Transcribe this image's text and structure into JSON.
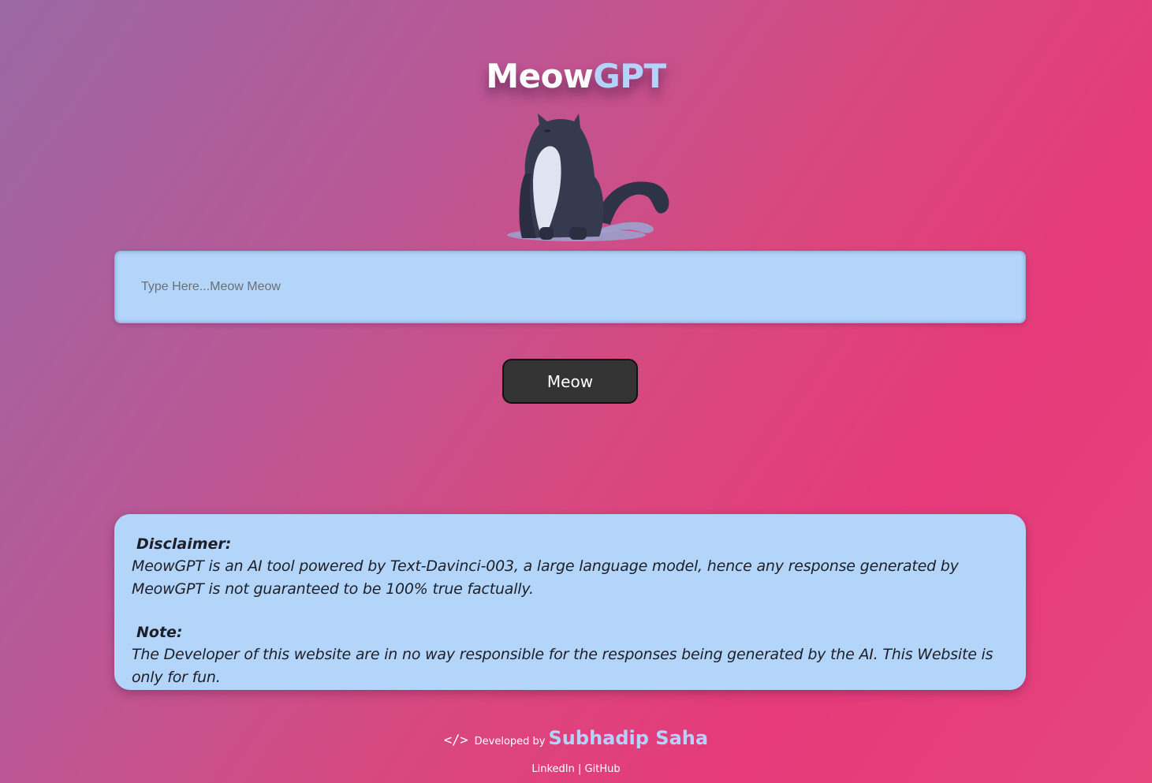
{
  "header": {
    "title_part1": "Meow",
    "title_part2": "GPT"
  },
  "prompt": {
    "placeholder": "Type Here...Meow Meow",
    "value": ""
  },
  "submit_button": {
    "label": "Meow"
  },
  "info": {
    "disclaimer_heading": "Disclaimer:",
    "disclaimer_text": "MeowGPT is an AI tool powered by Text-Davinci-003, a large language model, hence any response generated by MeowGPT is not guaranteed to be 100% true factually.",
    "note_heading": "Note:",
    "note_text": "The Developer of this website are in no way responsible for the responses being generated by the AI. This Website is only for fun."
  },
  "footer": {
    "code_icon": "</>",
    "developed_by": "Developed by",
    "author": "Subhadip Saha",
    "link_linkedin": "LinkedIn",
    "separator": "|",
    "link_github": "GitHub"
  },
  "colors": {
    "accent_light_blue": "#b3d5fa",
    "button_dark": "#333333",
    "gradient_start": "#9a68a4",
    "gradient_end": "#e63a7a"
  },
  "icons": {
    "mascot": "cat-illustration",
    "code": "code-icon"
  }
}
